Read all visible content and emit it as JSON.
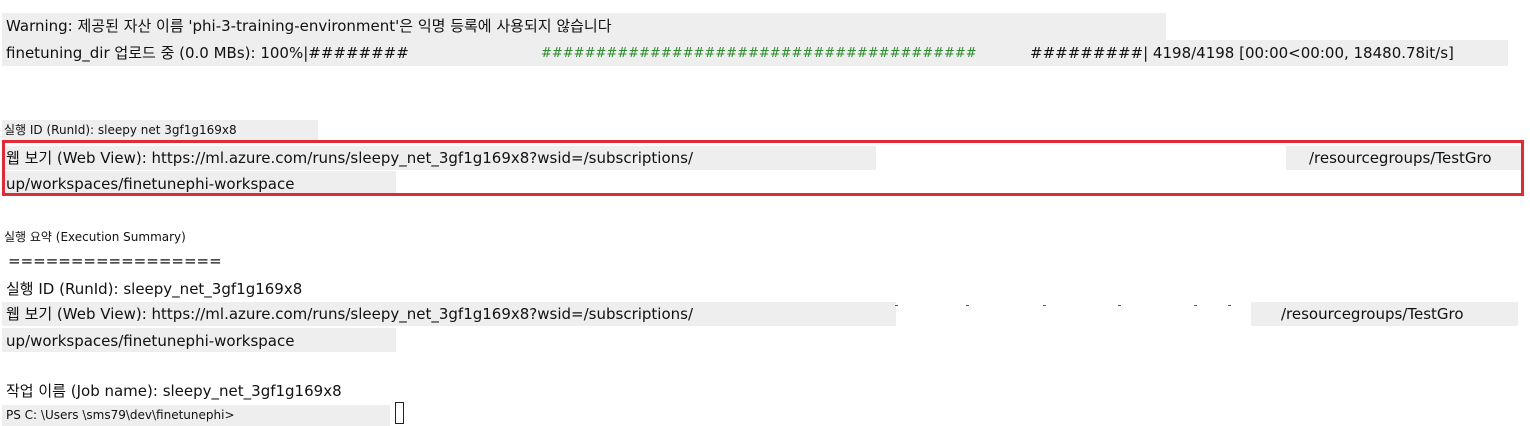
{
  "terminal": {
    "warning": "Warning: 제공된 자산 이름 'phi-3-training-environment'은 익명 등록에 사용되지 않습니다",
    "upload": {
      "prefix": "finetuning_dir 업로드 중 (0.0 MBs): 100%|########",
      "bar": "########################################",
      "suffix": "#########| 4198/4198 [00:00<00:00, 18480.78it/s]",
      "progress_percent": 100,
      "bar_color": "#2e8b2e"
    },
    "run_id_label": "실행 ID (RunId): sleepy net 3gf1g169x8",
    "web_view": {
      "line1_left": "웹 보기 (Web View): https://ml.azure.com/runs/sleepy_net_3gf1g169x8?wsid=/subscriptions/",
      "line1_right": "/resourcegroups/TestGro",
      "line2": "up/workspaces/finetunephi-workspace",
      "highlight_color": "#e02b35"
    },
    "summary": {
      "heading": "실행 요약 (Execution Summary)",
      "divider": "=================",
      "run_id": "실행 ID (RunId): sleepy_net_3gf1g169x8",
      "web_view_left": "웹 보기 (Web View): https://ml.azure.com/runs/sleepy_net_3gf1g169x8?wsid=/subscriptions/",
      "web_view_right": "/resourcegroups/TestGro",
      "web_view_line2": "up/workspaces/finetunephi-workspace"
    },
    "job_name": "작업 이름 (Job name): sleepy_net_3gf1g169x8",
    "prompt": "PS C: \\Users \\sms79\\dev\\finetunephi>"
  }
}
